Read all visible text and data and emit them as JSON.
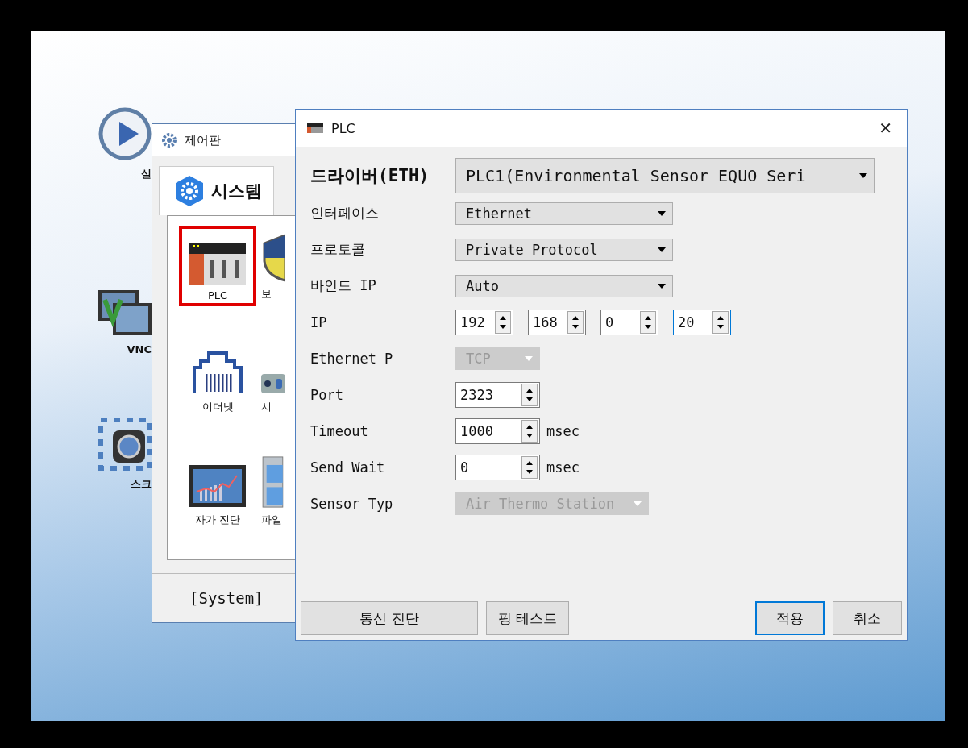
{
  "desktop": {
    "icons": [
      {
        "kind": "play",
        "label": "실"
      },
      {
        "kind": "vnc",
        "label": "VNC"
      },
      {
        "kind": "camera",
        "label": "스크"
      }
    ]
  },
  "control_panel": {
    "title": "제어판",
    "tabs": [
      {
        "label": "시스템",
        "selected": true
      }
    ],
    "items": [
      {
        "kind": "plc",
        "label": "PLC",
        "selected": true
      },
      {
        "kind": "shield",
        "label": "보",
        "selected": false
      },
      {
        "kind": "ethernet",
        "label": "이더넷",
        "selected": false
      },
      {
        "kind": "device",
        "label": "시",
        "selected": false
      },
      {
        "kind": "chart",
        "label": "자가 진단",
        "selected": false
      },
      {
        "kind": "cabinet",
        "label": "파일",
        "selected": false
      }
    ],
    "footer": "[System]"
  },
  "plc_window": {
    "title": "PLC",
    "close": "✕",
    "fields": [
      {
        "kind": "header_combo",
        "label": "드라이버(ETH)",
        "value": "PLC1(Environmental Sensor EQUO Seri",
        "disabled": false
      },
      {
        "kind": "combo",
        "label": "인터페이스",
        "value": "Ethernet",
        "disabled": false
      },
      {
        "kind": "combo",
        "label": "프로토콜",
        "value": "Private Protocol",
        "disabled": false
      },
      {
        "kind": "combo",
        "label": "바인드 IP",
        "value": "Auto",
        "disabled": false
      },
      {
        "kind": "ip",
        "label": "IP",
        "parts": [
          {
            "value": "192",
            "focused": false
          },
          {
            "value": "168",
            "focused": false
          },
          {
            "value": "0",
            "focused": false
          },
          {
            "value": "20",
            "focused": true
          }
        ]
      },
      {
        "kind": "short_combo",
        "label": "Ethernet P",
        "value": "TCP",
        "disabled": true
      },
      {
        "kind": "spin",
        "label": "Port",
        "value": "2323"
      },
      {
        "kind": "spin",
        "label": "Timeout",
        "value": "1000",
        "unit": "msec"
      },
      {
        "kind": "spin",
        "label": "Send Wait",
        "value": "0",
        "unit": "msec"
      },
      {
        "kind": "mid_combo",
        "label": "Sensor Typ",
        "value": "Air Thermo Station",
        "disabled": true
      }
    ],
    "left_buttons": [
      {
        "label": "통신 진단",
        "default": false
      },
      {
        "label": "핑 테스트",
        "default": false
      }
    ],
    "right_buttons": [
      {
        "label": "적용",
        "default": true
      },
      {
        "label": "취소",
        "default": false
      }
    ]
  }
}
